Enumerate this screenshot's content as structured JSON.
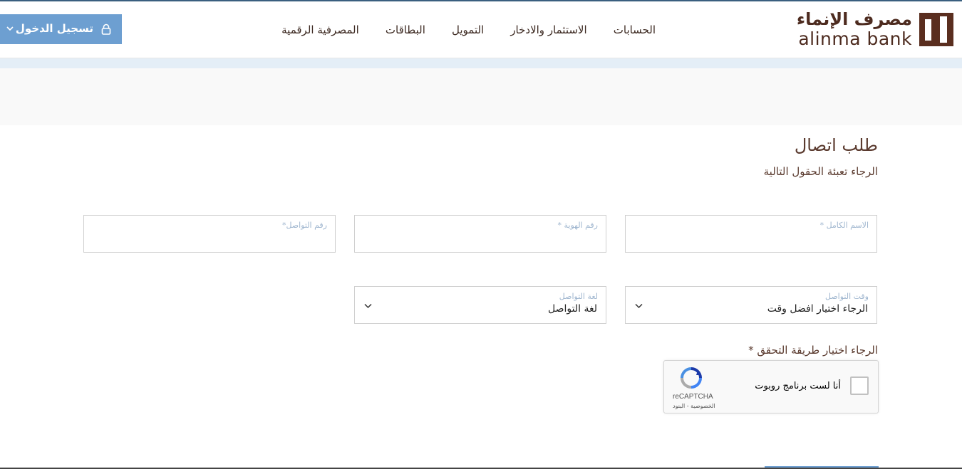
{
  "header": {
    "logo_ar": "مصرف الإنماء",
    "logo_en": "alinma bank",
    "nav": [
      "الحسابات",
      "الاستثمار والادخار",
      "التمويل",
      "البطاقات",
      "المصرفية الرقمية"
    ],
    "login_label": "تسجيل الدخول"
  },
  "form": {
    "title": "طلب اتصال",
    "subtitle": "الرجاء تعبئة الحقول التالية",
    "full_name_label": "الاسم الكامل *",
    "id_number_label": "رقم الهوية *",
    "contact_number_label": "رقم التواصل*",
    "contact_time_label": "وقت التواصل",
    "contact_time_value": "الرجاء اختيار افضل وقت",
    "language_label": "لغة التواصل",
    "language_value": "لغة التواصل",
    "verify_label": "الرجاء اختيار طريقة التحقق *"
  },
  "recaptcha": {
    "checkbox_label": "أنا لست برنامج روبوت",
    "brand": "reCAPTCHA",
    "links": "الخصوصية - البنود"
  },
  "colors": {
    "brand_brown": "#5a2e1f",
    "accent_blue": "#6d9fd1",
    "label_blue": "#9fb6cf"
  }
}
